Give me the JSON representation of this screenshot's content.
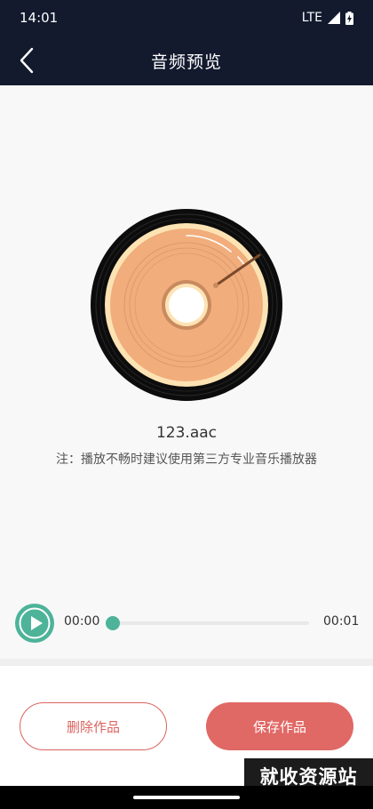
{
  "status_bar": {
    "time": "14:01",
    "network": "LTE"
  },
  "header": {
    "title": "音频预览"
  },
  "audio": {
    "filename": "123.aac",
    "notice": "注：播放不畅时建议使用第三方专业音乐播放器"
  },
  "player": {
    "current_time": "00:00",
    "total_time": "00:01",
    "progress": 0.02
  },
  "actions": {
    "delete_label": "删除作品",
    "save_label": "保存作品"
  },
  "watermark": {
    "text": "就收资源站"
  },
  "colors": {
    "header_bg": "#131a2e",
    "accent_green": "#4db399",
    "accent_red": "#e06865",
    "disc_orange": "#f1ad7c"
  }
}
